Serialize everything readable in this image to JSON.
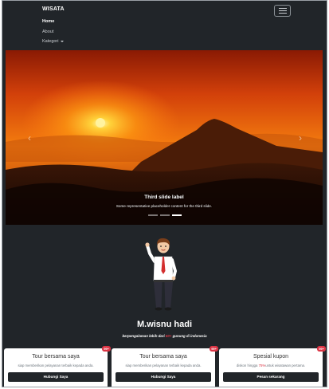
{
  "navbar": {
    "brand": "WISATA",
    "links": [
      {
        "label": "Home",
        "active": true
      },
      {
        "label": "About",
        "active": false
      },
      {
        "label": "Kategori",
        "active": false
      }
    ]
  },
  "carousel": {
    "caption_title": "Third slide label",
    "caption_text": "Some representative placeholder content for the third slide.",
    "prev_icon": "chevron-left-icon",
    "next_icon": "chevron-right-icon",
    "active_slide": 3,
    "slide_count": 3
  },
  "profile": {
    "name": "M.wisnu hadi",
    "tagline_pre": "berpengalaman lebih dari",
    "tagline_highlight": "50+",
    "tagline_post": "gunung di indonesia"
  },
  "cards": [
    {
      "badge": "99+",
      "title": "Tour bersama saya",
      "text_pre": "siap memberikan pelayanan terbaik kepada anda.",
      "text_highlight": "",
      "text_post": "",
      "button": "Hubungi Saya"
    },
    {
      "badge": "99+",
      "title": "Tour bersama saya",
      "text_pre": "siap memberikan pelayanan terbaik kepada anda.",
      "text_highlight": "",
      "text_post": "",
      "button": "Hubungi Saya"
    },
    {
      "badge": "99+",
      "title": "Spesial kupon",
      "text_pre": "diskon hingga",
      "text_highlight": "75%",
      "text_post": "untuk wisatawan pertama.",
      "button": "Pesan sekarang"
    }
  ],
  "colors": {
    "background": "#212529",
    "accent": "#dc3545"
  }
}
